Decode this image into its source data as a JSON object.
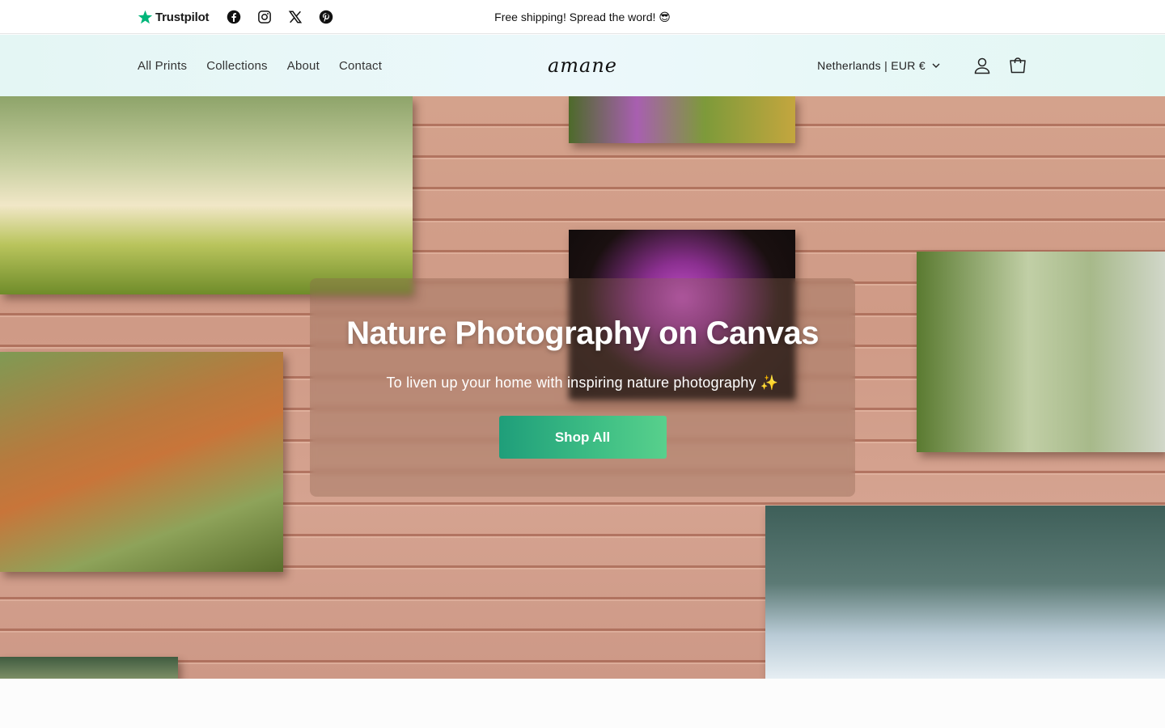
{
  "topbar": {
    "trustpilot_label": "Trustpilot",
    "social_icons": [
      "facebook-icon",
      "instagram-icon",
      "x-icon",
      "pinterest-icon"
    ],
    "announcement": "Free shipping! Spread the word! 😎"
  },
  "header": {
    "nav": [
      "All Prints",
      "Collections",
      "About",
      "Contact"
    ],
    "logo": "amane",
    "locale": "Netherlands | EUR €",
    "icons": [
      "account-icon",
      "cart-icon"
    ]
  },
  "hero": {
    "title": "Nature Photography on Canvas",
    "subtitle": "To liven up your home with inspiring nature photography ✨",
    "button_label": "Shop All"
  },
  "colors": {
    "accent_start": "#1f9e7a",
    "accent_end": "#58d08c",
    "trustpilot_green": "#00b67a"
  }
}
